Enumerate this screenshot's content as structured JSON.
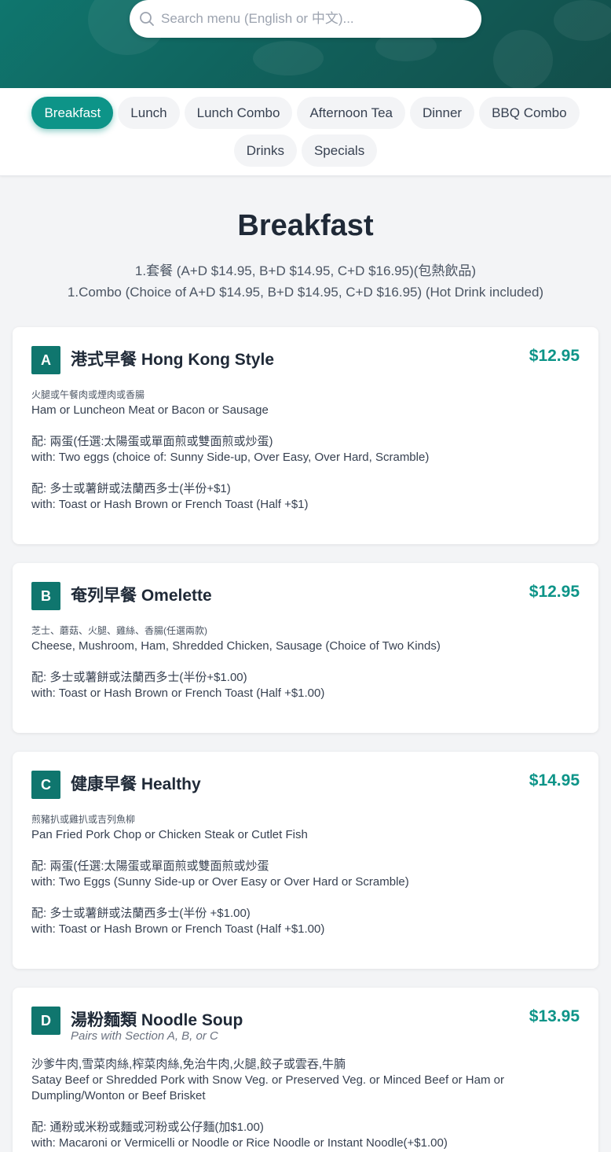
{
  "search": {
    "placeholder": "Search menu (English or 中文)..."
  },
  "categories": [
    "Breakfast",
    "Lunch",
    "Lunch Combo",
    "Afternoon Tea",
    "Dinner",
    "BBQ Combo",
    "Drinks",
    "Specials"
  ],
  "active_category": "Breakfast",
  "colors": {
    "accent": "#0d9488",
    "header": "#0f766e",
    "background": "#f3f4f6"
  },
  "section": {
    "title": "Breakfast",
    "subtitle_cn": "1.套餐 (A+D $14.95, B+D $14.95, C+D $16.95)(包熱飲品)",
    "subtitle_en": "1.Combo (Choice of A+D $14.95, B+D $14.95, C+D $16.95) (Hot Drink included)"
  },
  "items": [
    {
      "badge": "A",
      "name": "港式早餐 Hong Kong Style",
      "price": "$12.95",
      "lines": [
        {
          "cn": "火腿或午餐肉或煙肉或香腸",
          "en": "Ham or Luncheon Meat or Bacon or Sausage"
        },
        {
          "cn": "配: 兩蛋(任選:太陽蛋或單面煎或雙面煎或炒蛋)",
          "en": "with: Two eggs (choice of: Sunny Side-up, Over Easy, Over Hard, Scramble)"
        },
        {
          "cn": "配: 多士或薯餅或法蘭西多士(半份+$1)",
          "en": "with: Toast or Hash Brown or French Toast (Half +$1)"
        }
      ]
    },
    {
      "badge": "B",
      "name": "奄列早餐 Omelette",
      "price": "$12.95",
      "lines": [
        {
          "cn": "芝士、蘑菇、火腿、雞絲、香腸(任選兩款)",
          "en": "Cheese, Mushroom, Ham, Shredded Chicken, Sausage (Choice of Two Kinds)"
        },
        {
          "cn": "配: 多士或薯餅或法蘭西多士(半份+$1.00)",
          "en": "with: Toast or Hash Brown or French Toast (Half +$1.00)"
        }
      ]
    },
    {
      "badge": "C",
      "name": "健康早餐 Healthy",
      "price": "$14.95",
      "lines": [
        {
          "cn": "煎豬扒或雞扒或吉列魚柳",
          "en": "Pan Fried Pork Chop or Chicken Steak or Cutlet Fish"
        },
        {
          "cn": "配: 兩蛋(任選:太陽蛋或單面煎或雙面煎或炒蛋",
          "en": "with: Two Eggs (Sunny Side-up or Over Easy or Over Hard or Scramble)"
        },
        {
          "cn": "配: 多士或薯餅或法蘭西多士(半份 +$1.00)",
          "en": "with: Toast or Hash Brown or French Toast (Half +$1.00)"
        }
      ]
    },
    {
      "badge": "D",
      "name": "湯粉麵類 Noodle Soup",
      "note": "Pairs with Section A, B, or C",
      "price": "$13.95",
      "lines": [
        {
          "cn": "沙爹牛肉,雪菜肉絲,榨菜肉絲,免治牛肉,火腿,餃子或雲吞,牛腩",
          "en": "Satay Beef or Shredded Pork with Snow Veg. or Preserved Veg. or Minced Beef or Ham or Dumpling/Wonton or Beef Brisket"
        },
        {
          "cn": "配: 通粉或米粉或麵或河粉或公仔麵(加$1.00)",
          "en": "with: Macaroni or Vermicelli or Noodle or Rice Noodle or Instant Noodle(+$1.00)"
        }
      ]
    }
  ]
}
